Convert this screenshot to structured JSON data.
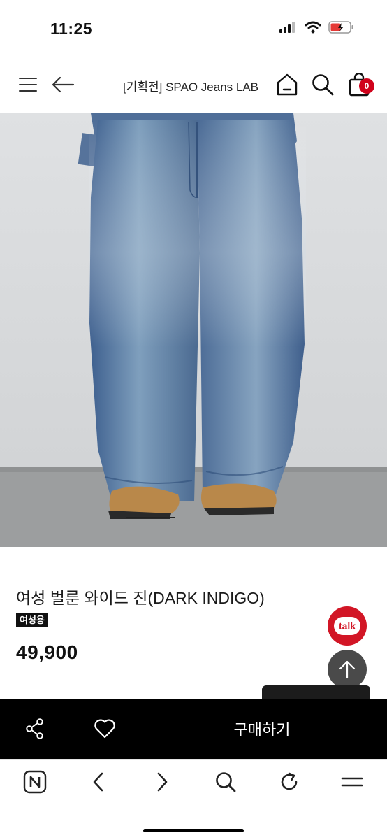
{
  "status_bar": {
    "time": "11:25"
  },
  "header": {
    "title": "[기획전] SPAO Jeans LAB",
    "cart_count": "0"
  },
  "product": {
    "name": "여성 벌룬 와이드 진(DARK INDIGO)",
    "badge": "여성용",
    "price": "49,900"
  },
  "floating": {
    "talk_label": "talk"
  },
  "buy_bar": {
    "buy_label": "구매하기"
  },
  "colors": {
    "accent_red": "#d21626",
    "buy_bar": "#000000"
  }
}
